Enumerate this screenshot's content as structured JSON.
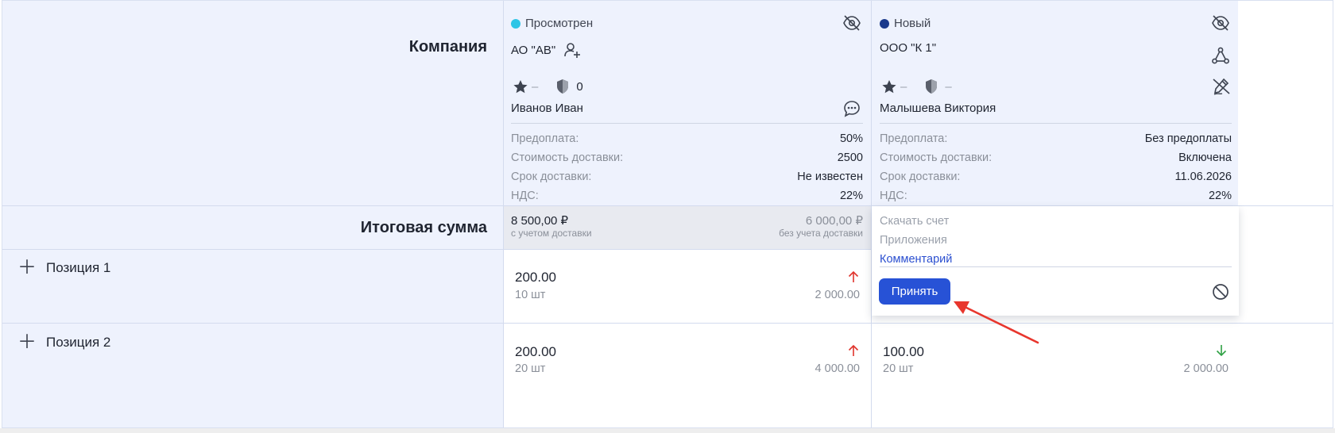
{
  "rows": {
    "company_label": "Компания",
    "total_label": "Итоговая сумма",
    "positions": [
      {
        "label": "Позиция 1"
      },
      {
        "label": "Позиция 2"
      }
    ]
  },
  "offers": [
    {
      "status": "Просмотрен",
      "status_color": "#2ec5e6",
      "company": "АО \"АВ\"",
      "rating": "–",
      "shield_value": "0",
      "person": "Иванов Иван",
      "details": [
        {
          "key": "Предоплата:",
          "value": "50%"
        },
        {
          "key": "Стоимость доставки:",
          "value": "2500"
        },
        {
          "key": "Срок доставки:",
          "value": "Не известен"
        },
        {
          "key": "НДС:",
          "value": "22%"
        }
      ],
      "total_with_delivery": "8 500,00 ₽",
      "total_with_delivery_note": "с учетом доставки",
      "total_without_delivery": "6 000,00 ₽",
      "total_without_delivery_note": "без учета доставки",
      "positions": [
        {
          "price": "200.00",
          "qty": "10 шт",
          "total": "2 000.00",
          "trend": "up"
        },
        {
          "price": "200.00",
          "qty": "20 шт",
          "total": "4 000.00",
          "trend": "up"
        }
      ]
    },
    {
      "status": "Новый",
      "status_color": "#1b3a8c",
      "company": "ООО \"К 1\"",
      "rating": "–",
      "shield_value": "–",
      "person": "Малышева Виктория",
      "details": [
        {
          "key": "Предоплата:",
          "value": "Без предоплаты"
        },
        {
          "key": "Стоимость доставки:",
          "value": "Включена"
        },
        {
          "key": "Срок доставки:",
          "value": "11.06.2026"
        },
        {
          "key": "НДС:",
          "value": "22%"
        }
      ],
      "actions": {
        "download_invoice": "Скачать счет",
        "attachments": "Приложения",
        "comment": "Комментарий",
        "accept": "Принять"
      },
      "positions": [
        {
          "price": "100.00",
          "qty": "20 шт",
          "total": "2 000.00",
          "trend": "down"
        }
      ]
    }
  ],
  "colors": {
    "accent": "#2752d6",
    "trend_up": "#e0332b",
    "trend_down": "#2ea043",
    "annotation_arrow": "#e8362d"
  }
}
